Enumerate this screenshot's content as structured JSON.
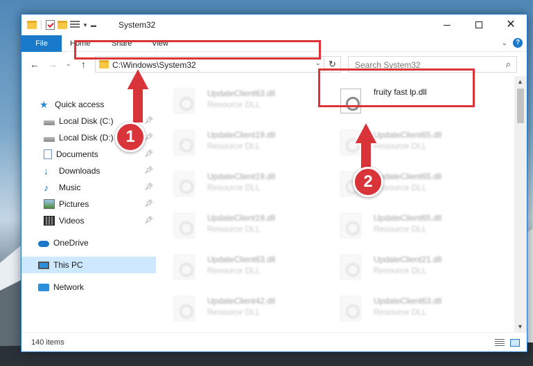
{
  "window": {
    "title": "System32"
  },
  "ribbon": {
    "tabs": {
      "file": "File",
      "home": "Home",
      "share": "Share",
      "view": "View"
    },
    "help": "?"
  },
  "nav": {
    "address": "C:\\Windows\\System32",
    "search_placeholder": "Search System32"
  },
  "sidebar": {
    "items": [
      {
        "label": "Quick access",
        "icon": "star-icon"
      },
      {
        "label": "Local Disk (C:)",
        "icon": "disk-icon"
      },
      {
        "label": "Local Disk (D:)",
        "icon": "disk-icon"
      },
      {
        "label": "Documents",
        "icon": "documents-icon"
      },
      {
        "label": "Downloads",
        "icon": "download-icon"
      },
      {
        "label": "Music",
        "icon": "music-icon"
      },
      {
        "label": "Pictures",
        "icon": "pictures-icon"
      },
      {
        "label": "Videos",
        "icon": "videos-icon"
      },
      {
        "label": "OneDrive",
        "icon": "cloud-icon"
      },
      {
        "label": "This PC",
        "icon": "computer-icon"
      },
      {
        "label": "Network",
        "icon": "network-icon"
      }
    ]
  },
  "files": {
    "left": [
      {
        "name": "UpdateClient63.dll",
        "type": "Resource DLL"
      },
      {
        "name": "UpdateClient19.dll",
        "type": "Resource DLL"
      },
      {
        "name": "UpdateClient19.dll",
        "type": "Resource DLL"
      },
      {
        "name": "UpdateClient19.dll",
        "type": "Resource DLL"
      },
      {
        "name": "UpdateClient63.dll",
        "type": "Resource DLL"
      },
      {
        "name": "UpdateClient42.dll",
        "type": "Resource DLL"
      }
    ],
    "right": [
      {
        "name": "fruity fast lp.dll",
        "type": ""
      },
      {
        "name": "UpdateClient65.dll",
        "type": "Resource DLL"
      },
      {
        "name": "UpdateClient65.dll",
        "type": "Resource DLL"
      },
      {
        "name": "UpdateClient65.dll",
        "type": "Resource DLL"
      },
      {
        "name": "UpdateClient21.dll",
        "type": "Resource DLL"
      },
      {
        "name": "UpdateClient63.dll",
        "type": "Resource DLL"
      }
    ]
  },
  "status": {
    "item_count": "140 items"
  },
  "callouts": {
    "one": "1",
    "two": "2"
  },
  "colors": {
    "accent": "#1979ca",
    "highlight": "#d9343a",
    "selection": "#cde8ff"
  }
}
